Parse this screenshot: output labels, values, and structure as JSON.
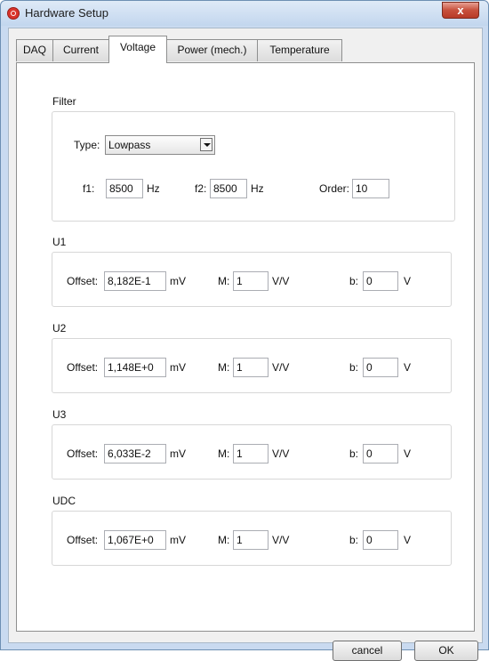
{
  "window": {
    "title": "Hardware Setup",
    "close_glyph": "x"
  },
  "tabs": [
    {
      "label": "DAQ"
    },
    {
      "label": "Current"
    },
    {
      "label": "Voltage"
    },
    {
      "label": "Power (mech.)"
    },
    {
      "label": "Temperature"
    }
  ],
  "active_tab": "Voltage",
  "filter": {
    "group_label": "Filter",
    "type_label": "Type:",
    "type_value": "Lowpass",
    "f1_label": "f1:",
    "f1_value": "8500",
    "f1_unit": "Hz",
    "f2_label": "f2:",
    "f2_value": "8500",
    "f2_unit": "Hz",
    "order_label": "Order:",
    "order_value": "10"
  },
  "channels": [
    {
      "label": "U1",
      "offset_label": "Offset:",
      "offset": "8,182E-1",
      "offset_unit": "mV",
      "m_label": "M:",
      "m": "1",
      "m_unit": "V/V",
      "b_label": "b:",
      "b": "0",
      "b_unit": "V"
    },
    {
      "label": "U2",
      "offset_label": "Offset:",
      "offset": "1,148E+0",
      "offset_unit": "mV",
      "m_label": "M:",
      "m": "1",
      "m_unit": "V/V",
      "b_label": "b:",
      "b": "0",
      "b_unit": "V"
    },
    {
      "label": "U3",
      "offset_label": "Offset:",
      "offset": "6,033E-2",
      "offset_unit": "mV",
      "m_label": "M:",
      "m": "1",
      "m_unit": "V/V",
      "b_label": "b:",
      "b": "0",
      "b_unit": "V"
    },
    {
      "label": "UDC",
      "offset_label": "Offset:",
      "offset": "1,067E+0",
      "offset_unit": "mV",
      "m_label": "M:",
      "m": "1",
      "m_unit": "V/V",
      "b_label": "b:",
      "b": "0",
      "b_unit": "V"
    }
  ],
  "buttons": {
    "cancel": "cancel",
    "ok": "OK"
  },
  "colors": {
    "titlebar": "#c9daf0",
    "close": "#c7503c",
    "panel": "#ffffff"
  }
}
